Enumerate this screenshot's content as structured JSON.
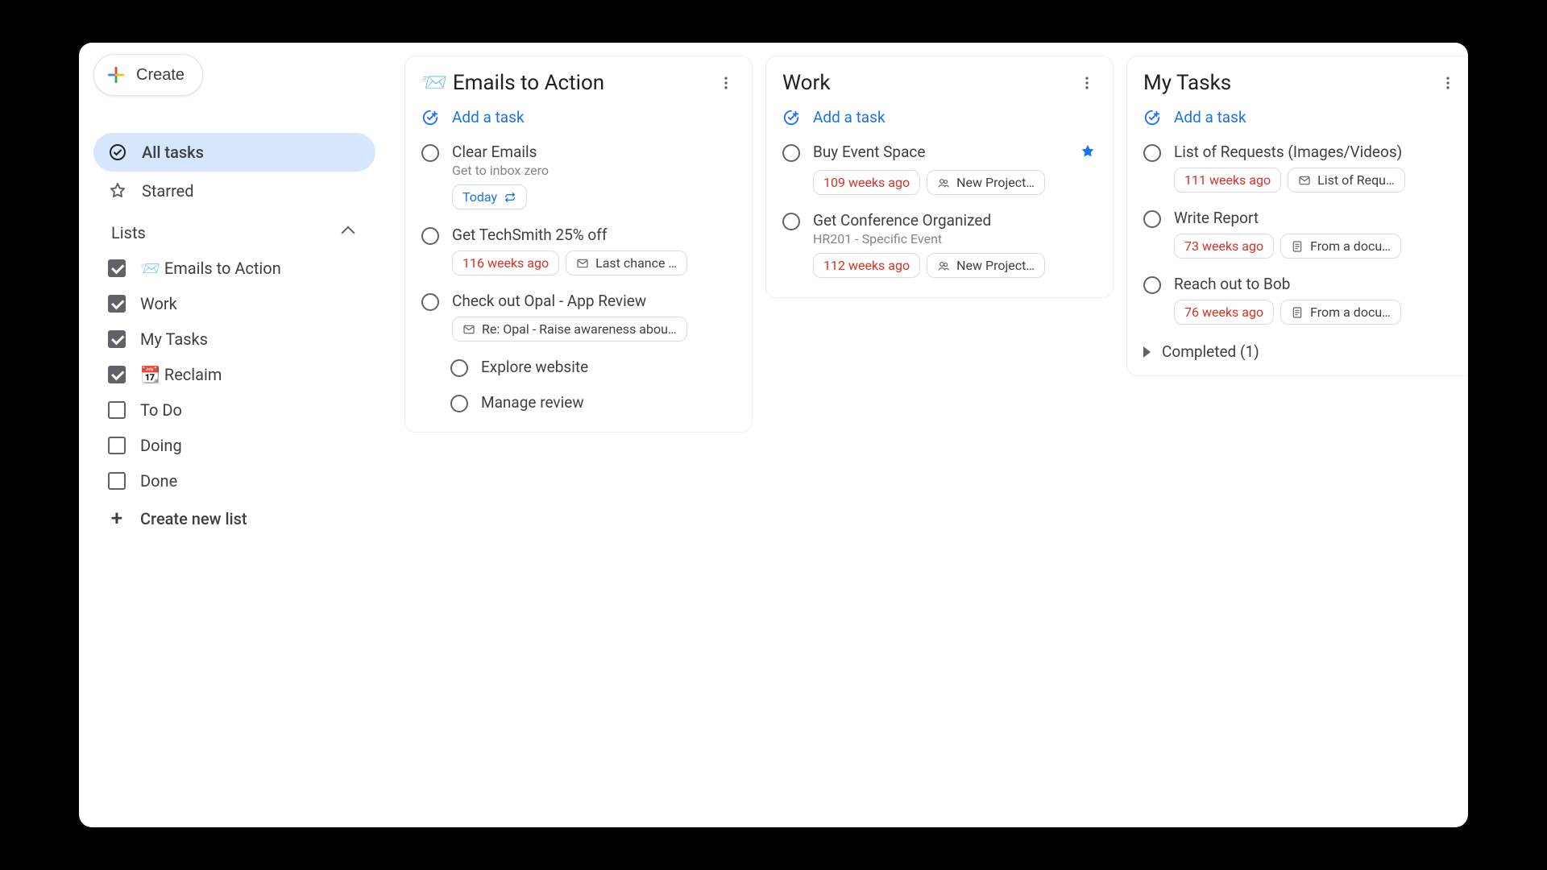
{
  "sidebar": {
    "create_label": "Create",
    "nav": {
      "all_tasks": "All tasks",
      "starred": "Starred"
    },
    "lists_header": "Lists",
    "lists": [
      {
        "label": "📨 Emails to Action",
        "checked": true
      },
      {
        "label": "Work",
        "checked": true
      },
      {
        "label": "My Tasks",
        "checked": true
      },
      {
        "label": "📆 Reclaim",
        "checked": true
      },
      {
        "label": "To Do",
        "checked": false
      },
      {
        "label": "Doing",
        "checked": false
      },
      {
        "label": "Done",
        "checked": false
      }
    ],
    "create_new_list": "Create new list"
  },
  "columns": [
    {
      "title": "📨 Emails to Action",
      "add_task_label": "Add a task",
      "tasks": [
        {
          "title": "Clear Emails",
          "subtitle": "Get to inbox zero",
          "chips": [
            {
              "type": "repeat",
              "text": "Today",
              "class": "blue-text"
            }
          ]
        },
        {
          "title": "Get TechSmith 25% off",
          "chips": [
            {
              "type": "due",
              "text": "116 weeks ago",
              "class": "due"
            },
            {
              "type": "mail",
              "text": "Last chance …"
            }
          ]
        },
        {
          "title": "Check out Opal - App Review",
          "chips": [
            {
              "type": "mail",
              "text": "Re: Opal - Raise awareness abou…",
              "class": "wide"
            }
          ],
          "subtasks": [
            {
              "title": "Explore website"
            },
            {
              "title": "Manage review"
            }
          ]
        }
      ]
    },
    {
      "title": "Work",
      "add_task_label": "Add a task",
      "tasks": [
        {
          "title": "Buy Event Space",
          "starred": true,
          "chips": [
            {
              "type": "due",
              "text": "109 weeks ago",
              "class": "due"
            },
            {
              "type": "space",
              "text": "New Project…"
            }
          ]
        },
        {
          "title": "Get Conference Organized",
          "subtitle": "HR201 - Specific Event",
          "chips": [
            {
              "type": "due",
              "text": "112 weeks ago",
              "class": "due"
            },
            {
              "type": "space",
              "text": "New Project…"
            }
          ]
        }
      ]
    },
    {
      "title": "My Tasks",
      "add_task_label": "Add a task",
      "tasks": [
        {
          "title": "List of Requests (Images/Videos)",
          "chips": [
            {
              "type": "due",
              "text": "111 weeks ago",
              "class": "due"
            },
            {
              "type": "mail",
              "text": "List of Requ…"
            }
          ]
        },
        {
          "title": "Write Report",
          "chips": [
            {
              "type": "due",
              "text": "73 weeks ago",
              "class": "due"
            },
            {
              "type": "doc",
              "text": "From a docu…"
            }
          ]
        },
        {
          "title": "Reach out to Bob",
          "chips": [
            {
              "type": "due",
              "text": "76 weeks ago",
              "class": "due"
            },
            {
              "type": "doc",
              "text": "From a docu…"
            }
          ]
        }
      ],
      "completed_label": "Completed (1)"
    }
  ]
}
